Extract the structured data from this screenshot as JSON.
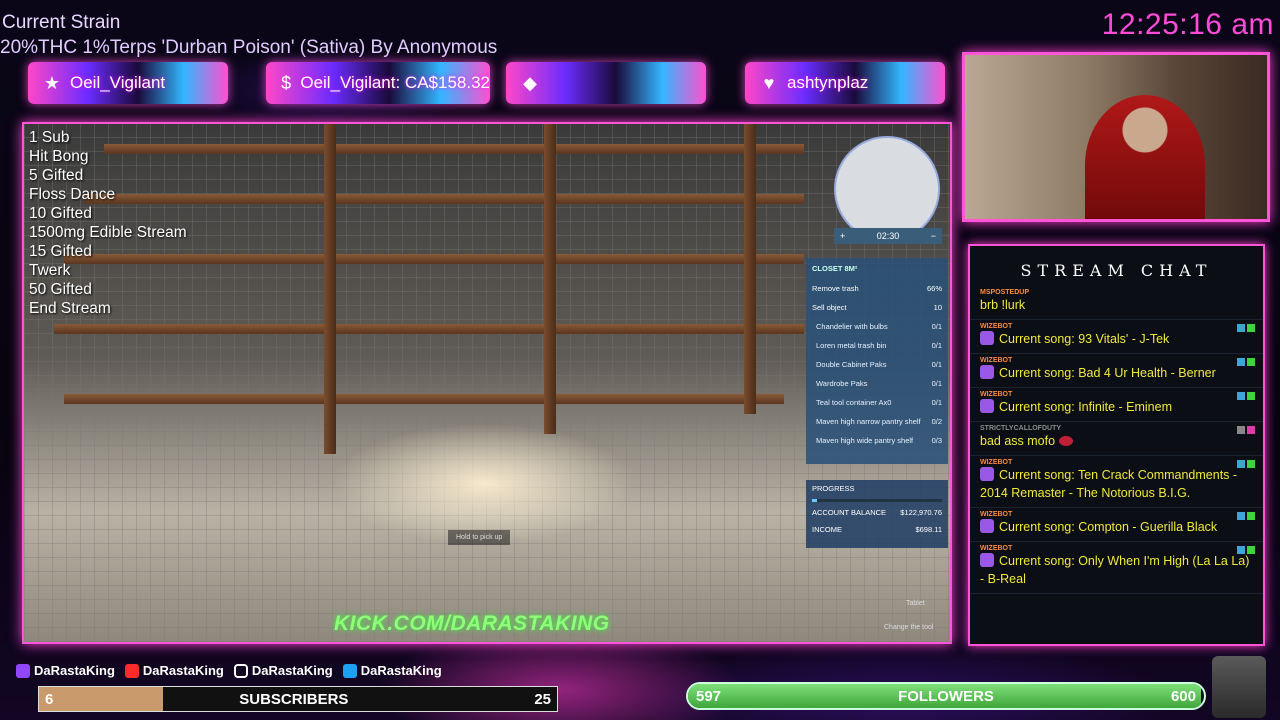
{
  "header": {
    "strain_title": "Current Strain",
    "strain_desc": "20%THC 1%Terps 'Durban Poison' (Sativa) By Anonymous",
    "clock": "12:25:16 am"
  },
  "alerts": [
    {
      "icon": "star-icon",
      "label": "Oeil_Vigilant"
    },
    {
      "icon": "dollar-icon",
      "label": "Oeil_Vigilant: CA$158.32"
    },
    {
      "icon": "diamond-icon",
      "label": ""
    },
    {
      "icon": "heart-icon",
      "label": "ashtynplaz"
    }
  ],
  "goals": [
    "1 Sub",
    "Hit Bong",
    "5 Gifted",
    "Floss Dance",
    "10 Gifted",
    "1500mg Edible Stream",
    "15 Gifted",
    "Twerk",
    "50 Gifted",
    "End Stream"
  ],
  "game": {
    "minimap_time": "02:30",
    "minimap_plus": "+",
    "minimap_minus": "−",
    "panel_header": "CLOSET 8M²",
    "tasks": [
      {
        "label": "Remove trash",
        "value": "66%",
        "highlight": true
      },
      {
        "label": "Sell object",
        "value": "10",
        "highlight": true
      },
      {
        "label": "Chandelier with bulbs",
        "value": "0/1"
      },
      {
        "label": "Loren metal trash bin",
        "value": "0/1"
      },
      {
        "label": "Double Cabinet Paks",
        "value": "0/1"
      },
      {
        "label": "Wardrobe Paks",
        "value": "0/1"
      },
      {
        "label": "Teal tool container Ax0",
        "value": "0/1"
      },
      {
        "label": "Maven high narrow pantry shelf",
        "value": "0/2"
      },
      {
        "label": "Maven high wide pantry shelf",
        "value": "0/3"
      }
    ],
    "progress_label": "PROGRESS",
    "account_balance_label": "ACCOUNT BALANCE",
    "account_balance": "$122,970.76",
    "income_label": "INCOME",
    "income": "$698.11",
    "hold_hint": "Hold to pick up",
    "tablet_hint": "Tablet",
    "change_tool_hint": "Change the tool",
    "kick_url": "KICK.COM/DARASTAKING"
  },
  "chat": {
    "title": "STREAM CHAT",
    "messages": [
      {
        "user": "MSPOSTEDUP",
        "text": "brb !lurk",
        "song": false
      },
      {
        "user": "WIZEBOT",
        "text": "Current song: 93 Vitals' - J-Tek",
        "song": true
      },
      {
        "user": "WIZEBOT",
        "text": "Current song: Bad 4 Ur Health - Berner",
        "song": true
      },
      {
        "user": "WIZEBOT",
        "text": "Current song: Infinite - Eminem",
        "song": true
      },
      {
        "user": "STRICTLYCALLOFDUTY",
        "text": "bad ass mofo",
        "song": false,
        "emote": true
      },
      {
        "user": "WIZEBOT",
        "text": "Current song: Ten Crack Commandments - 2014 Remaster - The Notorious B.I.G.",
        "song": true
      },
      {
        "user": "WIZEBOT",
        "text": "Current song: Compton - Guerilla Black",
        "song": true
      },
      {
        "user": "WIZEBOT",
        "text": "Current song: Only When I'm High (La La La) - B-Real",
        "song": true
      }
    ]
  },
  "socials": [
    {
      "icon": "twitch-icon",
      "label": "DaRastaKing"
    },
    {
      "icon": "youtube-icon",
      "label": "DaRastaKing"
    },
    {
      "icon": "instagram-icon",
      "label": "DaRastaKing"
    },
    {
      "icon": "twitter-icon",
      "label": "DaRastaKing"
    }
  ],
  "subscribers": {
    "label": "SUBSCRIBERS",
    "current": "6",
    "goal": "25",
    "fraction": 0.24
  },
  "followers": {
    "label": "FOLLOWERS",
    "current": "597",
    "goal": "600",
    "fraction": 0.995
  },
  "colors": {
    "accent": "#ff55d6",
    "kick_green": "#8fff7a",
    "chat_text": "#f0ea3a",
    "clock": "#ff4bd8"
  }
}
